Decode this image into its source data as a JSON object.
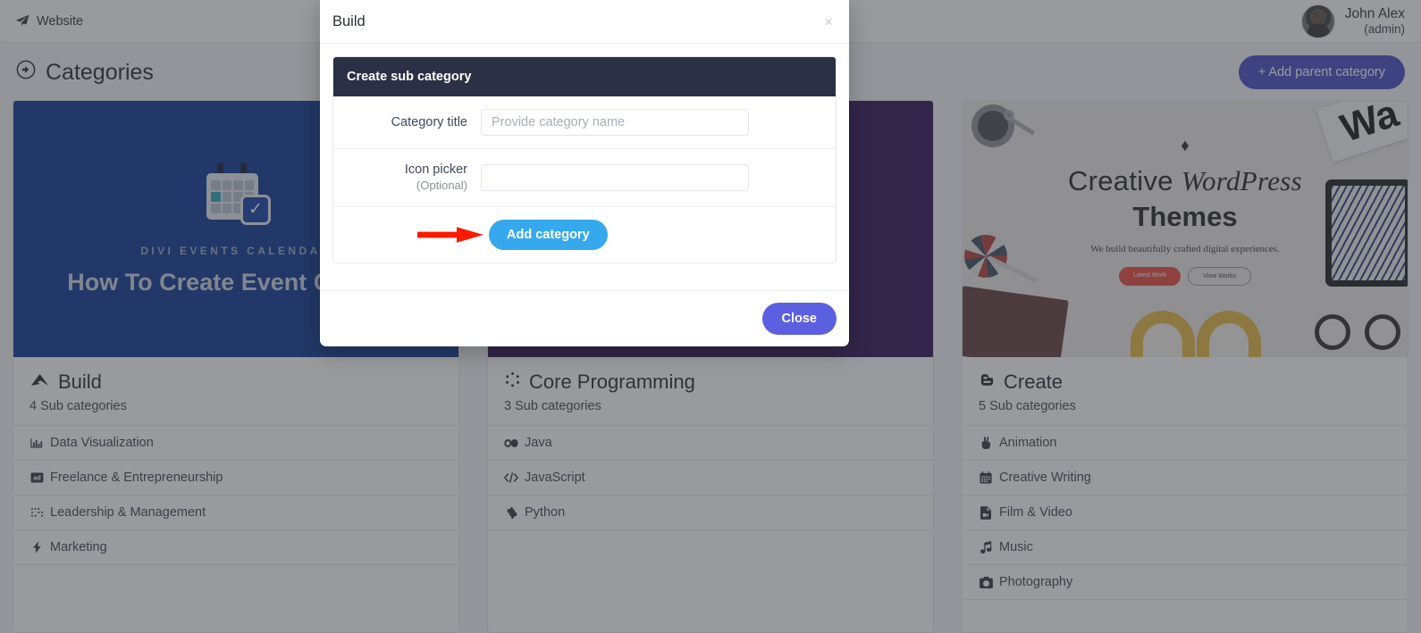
{
  "topbar": {
    "website_label": "Website",
    "website_icon": "paper-plane-icon",
    "user_name": "John Alex",
    "user_role": "(admin)"
  },
  "page": {
    "title": "Categories",
    "title_icon": "arrow-circle-right-icon",
    "add_parent_label": "+ Add parent category"
  },
  "cards": [
    {
      "title": "Build",
      "title_icon": "critical-role-icon",
      "sub_count_label": "4 Sub categories",
      "banner": {
        "eyebrow": "DIVI EVENTS CALENDAR",
        "headline": "How To Create Event Categor",
        "icon": "calendar-check-icon",
        "bg": "#073291"
      },
      "items": [
        {
          "label": "Data Visualization",
          "icon": "chart-bar-icon",
          "glyph": "█"
        },
        {
          "label": "Freelance & Entrepreneurship",
          "icon": "ad-icon",
          "glyph": "ad"
        },
        {
          "label": "Leadership & Management",
          "icon": "braille-icon",
          "glyph": "⣿"
        },
        {
          "label": "Marketing",
          "icon": "bolt-icon",
          "glyph": "⚡"
        }
      ]
    },
    {
      "title": "Core Programming",
      "title_icon": "spinner-dots-icon",
      "sub_count_label": "3 Sub categories",
      "banner": {
        "bg": "#290b53"
      },
      "items": [
        {
          "label": "Java",
          "icon": "glasses-icon",
          "glyph": "◐"
        },
        {
          "label": "JavaScript",
          "icon": "code-icon",
          "glyph": "</>"
        },
        {
          "label": "Python",
          "icon": "python-icon",
          "glyph": "✤"
        }
      ]
    },
    {
      "title": "Create",
      "title_icon": "blogger-b-icon",
      "sub_count_label": "5 Sub categories",
      "banner": {
        "gem_icon": "gem-icon",
        "line1_a": "Creative ",
        "line1_b": "WordPress",
        "line2": "Themes",
        "tagline": "We build beautifully crafted digital experiences.",
        "btn_primary": "Latest Work",
        "btn_secondary": "View Works",
        "magazine_text": "Wa"
      },
      "items": [
        {
          "label": "Animation",
          "icon": "hand-peace-icon",
          "glyph": "✌"
        },
        {
          "label": "Creative Writing",
          "icon": "calendar-alt-icon",
          "glyph": "☷"
        },
        {
          "label": "Film & Video",
          "icon": "file-video-icon",
          "glyph": "☷"
        },
        {
          "label": "Music",
          "icon": "music-icon",
          "glyph": "♪"
        },
        {
          "label": "Photography",
          "icon": "camera-icon",
          "glyph": "◉"
        }
      ]
    }
  ],
  "modal": {
    "title": "Build",
    "close_x": "×",
    "section_title": "Create sub category",
    "fields": [
      {
        "label": "Category title",
        "optional_note": "",
        "placeholder": "Provide category name",
        "value": ""
      },
      {
        "label": "Icon picker",
        "optional_note": "(Optional)",
        "placeholder": "",
        "value": ""
      }
    ],
    "add_button_label": "Add category",
    "close_button_label": "Close",
    "annotation_arrow": "red-arrow-pointing-right"
  },
  "colors": {
    "accent_primary": "#4347c4",
    "accent_add": "#36a9ee",
    "accent_close": "#5b5fe0",
    "header_dark": "#2c3044",
    "arrow_red": "#fb1b00"
  }
}
